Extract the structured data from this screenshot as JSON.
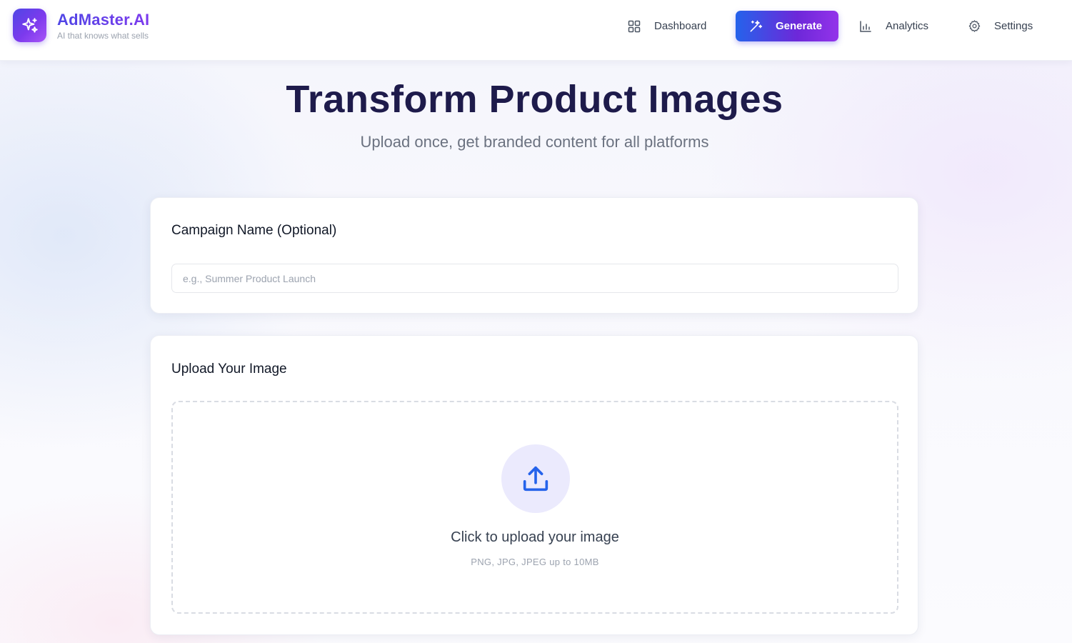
{
  "brand": {
    "name": "AdMaster.AI",
    "tagline": "AI that knows what sells",
    "logo_icon": "sparkles-icon",
    "colors": {
      "primary": "#4f46e5",
      "accent": "#7c3aed"
    }
  },
  "nav": {
    "items": [
      {
        "label": "Dashboard",
        "icon": "grid-icon",
        "active": false
      },
      {
        "label": "Generate",
        "icon": "magic-wand-icon",
        "active": true
      },
      {
        "label": "Analytics",
        "icon": "bar-chart-icon",
        "active": false
      },
      {
        "label": "Settings",
        "icon": "gear-icon",
        "active": false
      }
    ]
  },
  "hero": {
    "title": "Transform Product Images",
    "subtitle": "Upload once, get branded content for all platforms"
  },
  "campaign": {
    "label": "Campaign Name (Optional)",
    "value": "",
    "placeholder": "e.g., Summer Product Launch"
  },
  "upload": {
    "label": "Upload Your Image",
    "icon": "upload-icon",
    "prompt": "Click to upload your image",
    "hint": "PNG, JPG, JPEG up to 10MB"
  }
}
